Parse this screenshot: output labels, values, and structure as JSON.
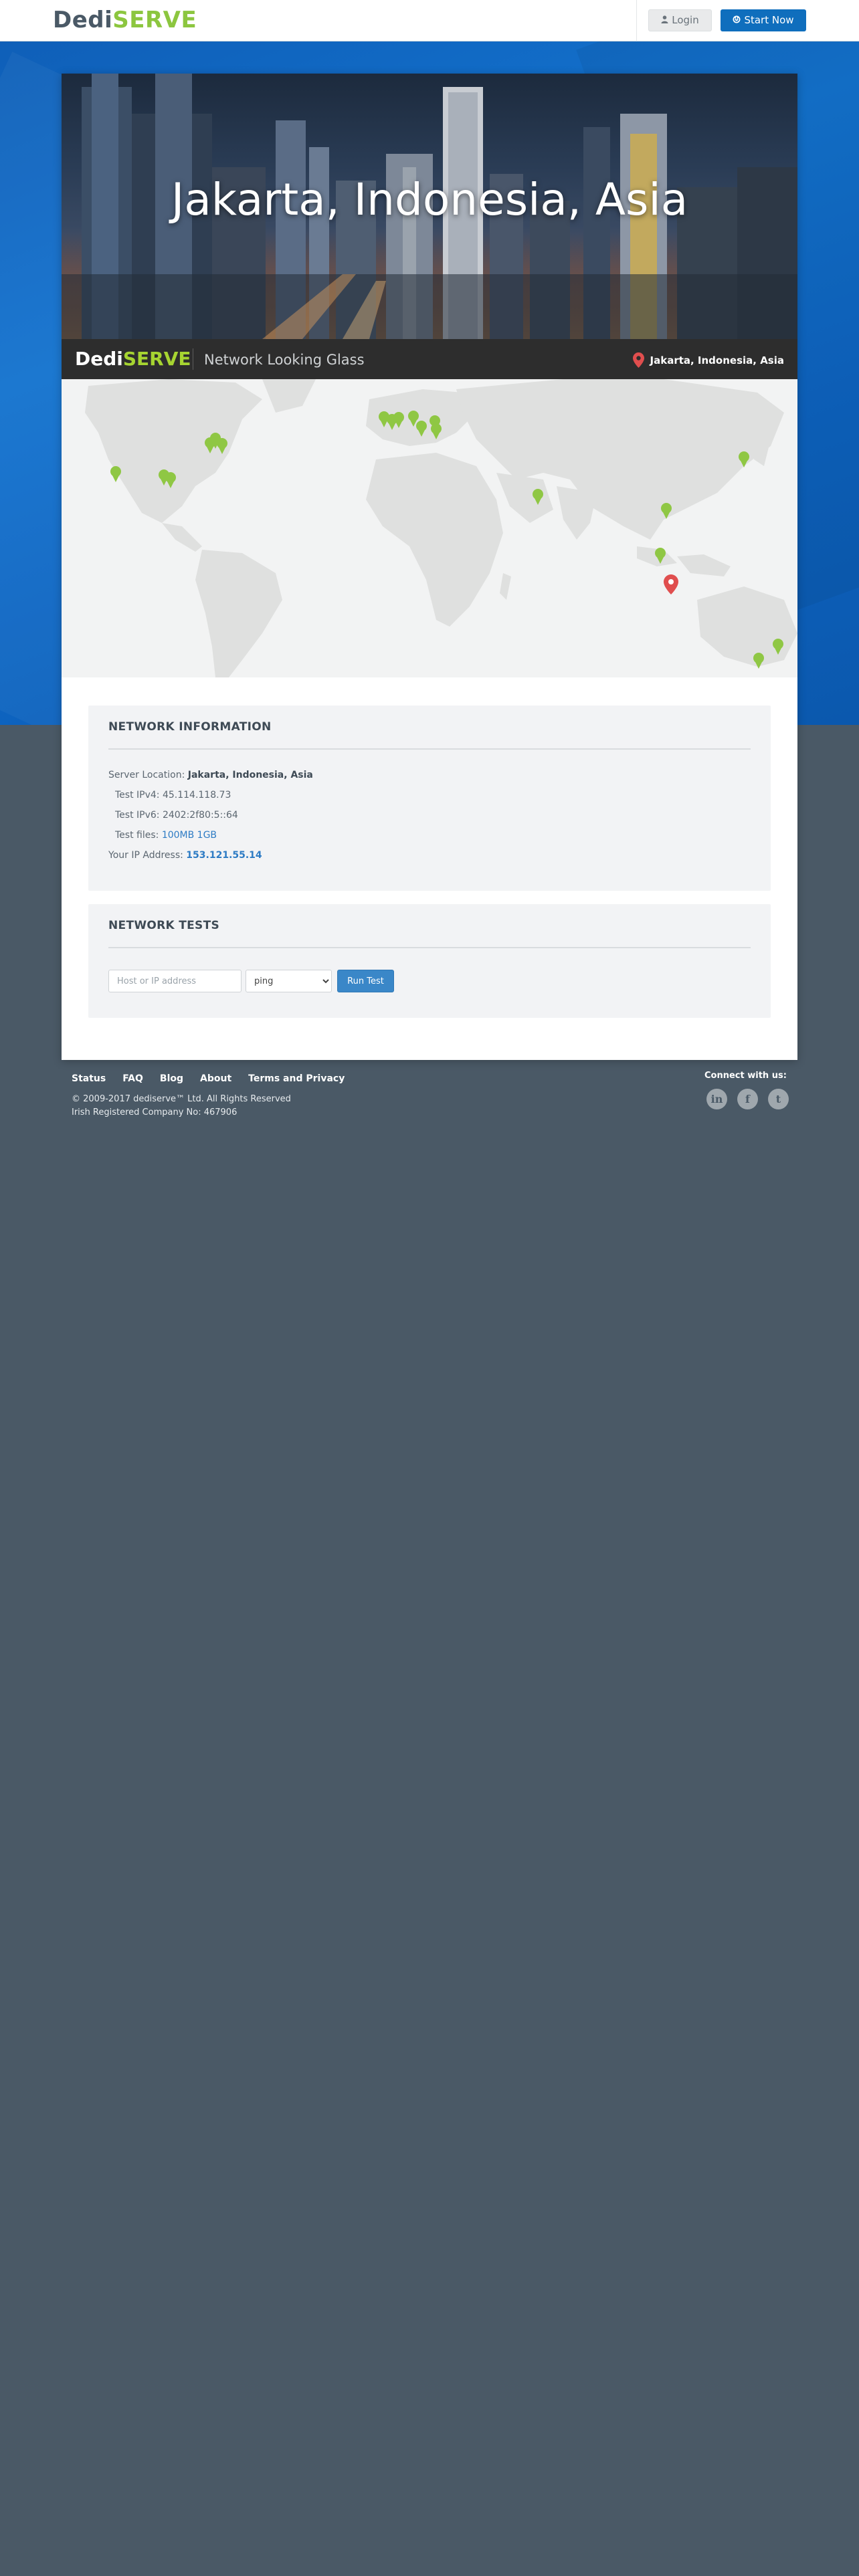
{
  "header": {
    "logo_dedi": "Dedi",
    "logo_serve": "SERVE",
    "login_label": "Login",
    "start_label": "Start Now"
  },
  "hero": {
    "title": "Jakarta, Indonesia, Asia"
  },
  "infobar": {
    "logo_dedi": "Dedi",
    "logo_serve": "SERVE",
    "subtitle": "Network Looking Glass",
    "location": "Jakarta, Indonesia, Asia"
  },
  "network_info": {
    "title": "NETWORK INFORMATION",
    "server_location_label": "Server Location:",
    "server_location_value": "Jakarta, Indonesia, Asia",
    "ipv4_label": "Test IPv4:",
    "ipv4_value": "45.114.118.73",
    "ipv6_label": "Test IPv6:",
    "ipv6_value": "2402:2f80:5::64",
    "files_label": "Test files:",
    "file_100mb": "100MB",
    "file_1gb": "1GB",
    "your_ip_label": "Your IP Address:",
    "your_ip_value": "153.121.55.14"
  },
  "network_tests": {
    "title": "NETWORK TESTS",
    "host_placeholder": "Host or IP address",
    "method_selected": "ping",
    "run_label": "Run Test"
  },
  "footer": {
    "links": [
      "Status",
      "FAQ",
      "Blog",
      "About",
      "Terms and Privacy"
    ],
    "copyright_line1": "© 2009-2017 dediserve™ Ltd. All Rights Reserved",
    "copyright_line2": "Irish Registered Company No: 467906",
    "connect_label": "Connect with us:"
  },
  "colors": {
    "brand_green": "#8cc63f",
    "brand_blue": "#0f6ebd",
    "marker_green": "#8fc744",
    "marker_red": "#e04e4e",
    "page_bg": "#4a5966"
  }
}
